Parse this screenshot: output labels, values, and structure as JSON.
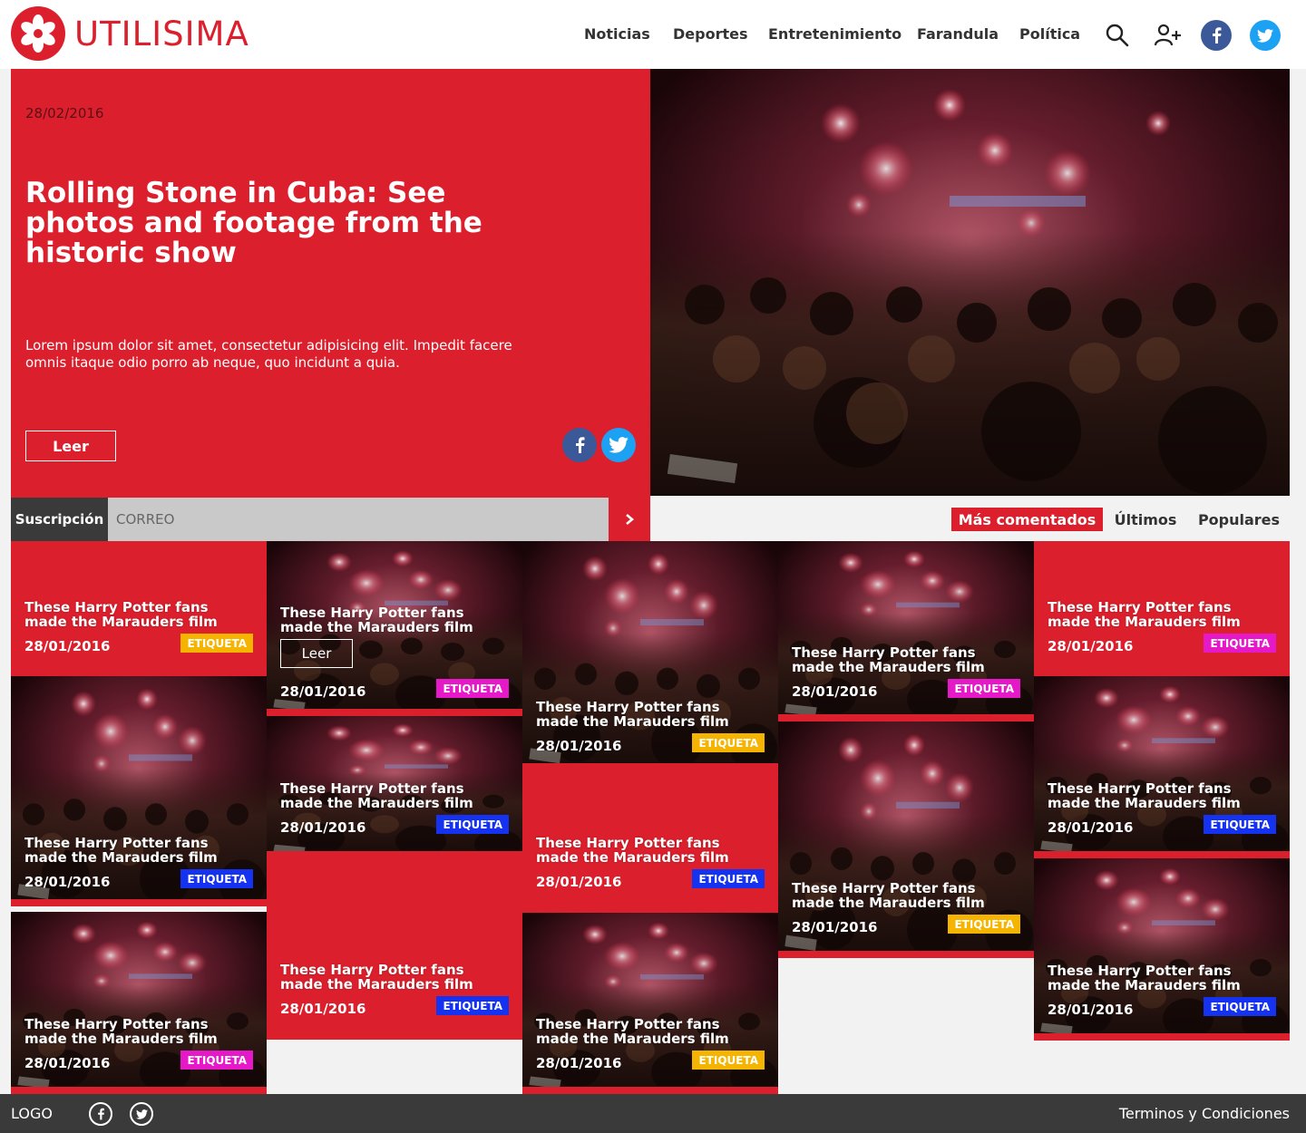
{
  "brand": {
    "name": "UTILISIMA",
    "color": "#dc1f2c"
  },
  "nav": {
    "items": [
      "Noticias",
      "Deportes",
      "Entretenimiento",
      "Farandula",
      "Política"
    ],
    "icons": [
      "search-icon",
      "google-plus-icon",
      "facebook-icon",
      "twitter-icon"
    ]
  },
  "hero": {
    "date": "28/02/2016",
    "title": "Rolling Stone in Cuba: See photos and footage from the historic show",
    "description": "Lorem ipsum dolor sit amet, consectetur adipisicing elit. Impedit facere omnis itaque odio porro ab neque, quo incidunt a quia.",
    "button": "Leer"
  },
  "subscription": {
    "label": "Suscripción",
    "placeholder": "CORREO"
  },
  "tabs": [
    {
      "label": "Más comentados",
      "active": true
    },
    {
      "label": "Últimos",
      "active": false
    },
    {
      "label": "Populares",
      "active": false
    }
  ],
  "tag_colors": {
    "yellow": "#f5b400",
    "magenta": "#e619c8",
    "blue": "#1432f0"
  },
  "cards": [
    {
      "kind": "red",
      "title": "These Harry Potter fans made the Marauders film",
      "date": "28/01/2016",
      "tag": "ETIQUETA",
      "tag_color": "yellow"
    },
    {
      "kind": "img",
      "title": "These Harry Potter fans made the Marauders film",
      "date": "28/01/2016",
      "tag": "ETIQUETA",
      "tag_color": "magenta"
    },
    {
      "kind": "img",
      "title": "These Harry Potter fans made the Marauders film",
      "date": "28/01/2016",
      "tag": "ETIQUETA",
      "tag_color": "blue"
    },
    {
      "kind": "img",
      "title": "These Harry Potter fans made the Marauders film",
      "date": "28/01/2016",
      "tag": "ETIQUETA",
      "tag_color": "magenta",
      "button": "Leer"
    },
    {
      "kind": "red",
      "title": "These Harry Potter fans made the Marauders film",
      "date": "28/01/2016",
      "tag": "ETIQUETA",
      "tag_color": "magenta"
    },
    {
      "kind": "img",
      "title": "These Harry Potter fans made the Marauders film",
      "date": "28/01/2016",
      "tag": "ETIQUETA",
      "tag_color": "blue"
    },
    {
      "kind": "img",
      "title": "These Harry Potter fans made the Marauders film",
      "date": "28/01/2016",
      "tag": "ETIQUETA",
      "tag_color": "yellow"
    },
    {
      "kind": "red",
      "title": "These Harry Potter fans made the Marauders film",
      "date": "28/01/2016",
      "tag": "ETIQUETA",
      "tag_color": "blue"
    },
    {
      "kind": "img",
      "title": "These Harry Potter fans made the Marauders film",
      "date": "28/01/2016",
      "tag": "ETIQUETA",
      "tag_color": "blue"
    },
    {
      "kind": "img",
      "title": "These Harry Potter fans made the Marauders film",
      "date": "28/01/2016",
      "tag": "ETIQUETA",
      "tag_color": "magenta"
    },
    {
      "kind": "img",
      "title": "These Harry Potter fans made the Marauders film",
      "date": "28/01/2016",
      "tag": "ETIQUETA",
      "tag_color": "yellow"
    },
    {
      "kind": "red",
      "title": "These Harry Potter fans made the Marauders film",
      "date": "28/01/2016",
      "tag": "ETIQUETA",
      "tag_color": "blue"
    },
    {
      "kind": "img",
      "title": "These Harry Potter fans made the Marauders film",
      "date": "28/01/2016",
      "tag": "ETIQUETA",
      "tag_color": "yellow"
    },
    {
      "kind": "img",
      "title": "These Harry Potter fans made the Marauders film",
      "date": "28/01/2016",
      "tag": "ETIQUETA",
      "tag_color": "blue"
    }
  ],
  "footer": {
    "logo": "LOGO",
    "icons": [
      "facebook-icon",
      "twitter-icon"
    ],
    "terms": "Terminos y Condiciones"
  }
}
